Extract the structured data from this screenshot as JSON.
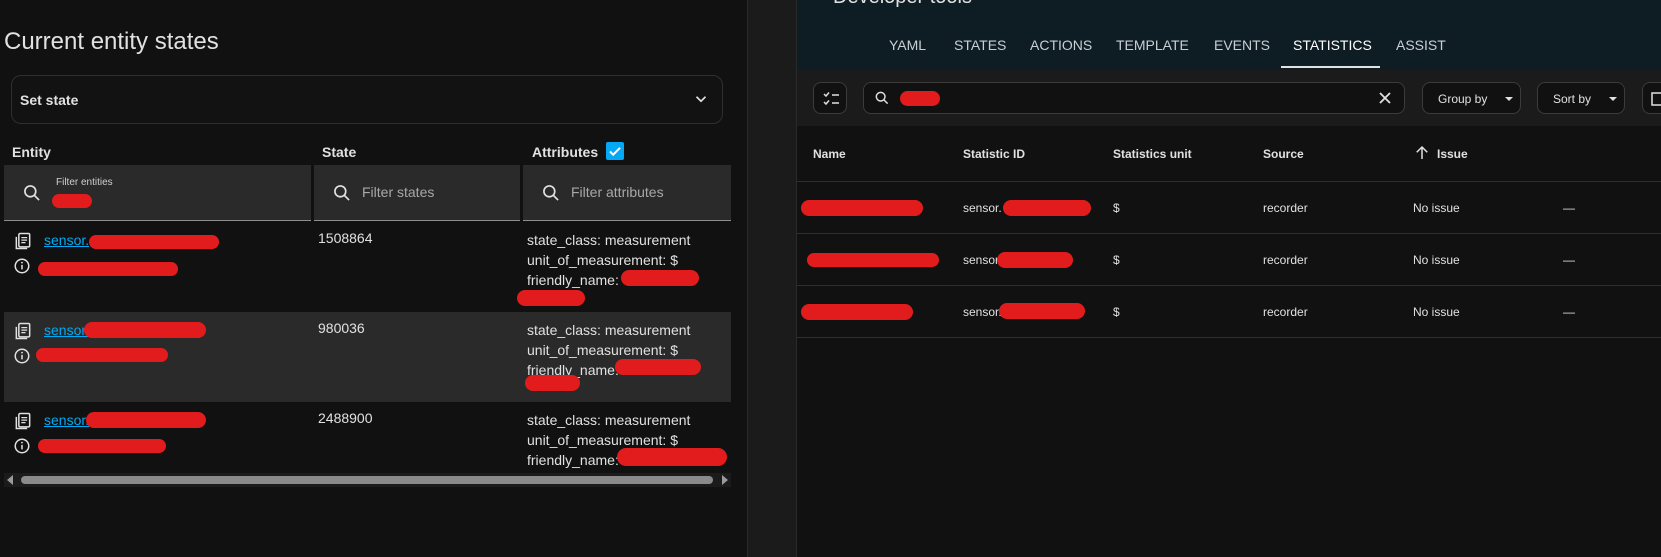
{
  "left": {
    "title": "Current entity states",
    "set_state_label": "Set state",
    "columns": {
      "entity": "Entity",
      "state": "State",
      "attributes": "Attributes"
    },
    "filters": {
      "entity_label": "Filter entities",
      "states_placeholder": "Filter states",
      "attributes_placeholder": "Filter attributes"
    },
    "rows": [
      {
        "entity_link": "sensor.",
        "state": "1508864",
        "attr1": "state_class: measurement",
        "attr2": "unit_of_measurement: $",
        "attr3": "friendly_name:"
      },
      {
        "entity_link": "sensor.",
        "state": "980036",
        "attr1": "state_class: measurement",
        "attr2": "unit_of_measurement: $",
        "attr3": "friendly_name:"
      },
      {
        "entity_link": "sensor.",
        "state": "2488900",
        "attr1": "state_class: measurement",
        "attr2": "unit_of_measurement: $",
        "attr3": "friendly_name:"
      }
    ]
  },
  "right": {
    "title": "Developer tools",
    "tabs": [
      "YAML",
      "STATES",
      "ACTIONS",
      "TEMPLATE",
      "EVENTS",
      "STATISTICS",
      "ASSIST"
    ],
    "active_tab": "STATISTICS",
    "group_by": "Group by",
    "sort_by": "Sort by",
    "columns": {
      "name": "Name",
      "statistic_id": "Statistic ID",
      "unit": "Statistics unit",
      "source": "Source",
      "issue": "Issue"
    },
    "rows": [
      {
        "statistic_id": "sensor.",
        "unit": "$",
        "source": "recorder",
        "issue": "No issue",
        "extra": "—"
      },
      {
        "statistic_id": "sensor.",
        "unit": "$",
        "source": "recorder",
        "issue": "No issue",
        "extra": "—"
      },
      {
        "statistic_id": "sensor.",
        "unit": "$",
        "source": "recorder",
        "issue": "No issue",
        "extra": "—"
      }
    ]
  },
  "colors": {
    "accent": "#03a9f4",
    "redaction": "#e21c1c",
    "background": "#111111",
    "topbar": "#0e1d24"
  }
}
